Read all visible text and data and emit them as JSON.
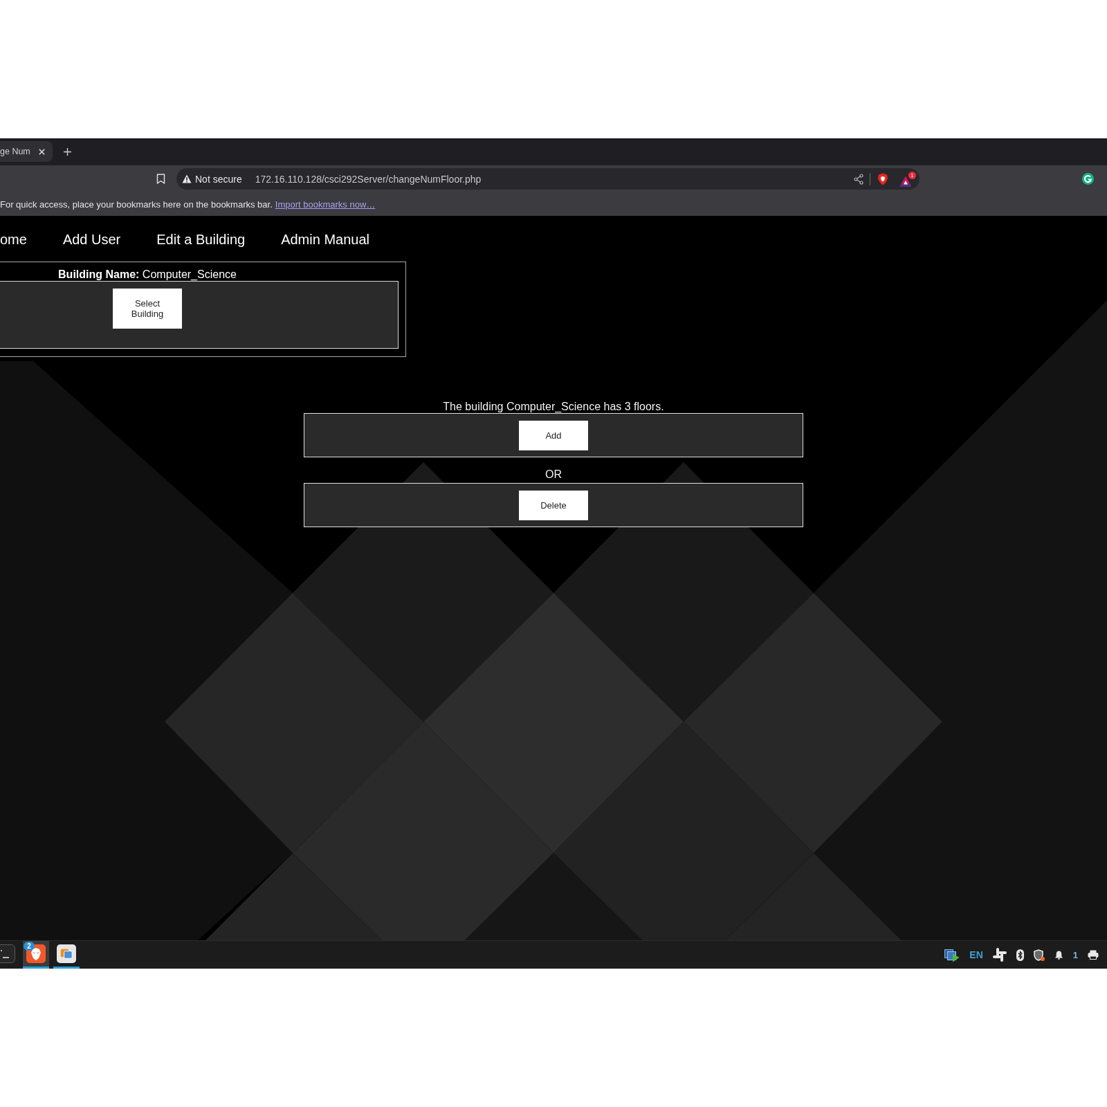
{
  "browser": {
    "tab": {
      "title": "ge Num"
    },
    "address_bar": {
      "security_label": "Not secure",
      "url": "172.16.110.128/csci292Server/changeNumFloor.php",
      "rewards_badge": "1"
    },
    "bookmarks_bar": {
      "hint": "For quick access, place your bookmarks here on the bookmarks bar.",
      "link": "Import bookmarks now…"
    }
  },
  "nav": {
    "items": [
      {
        "label": "ome"
      },
      {
        "label": "Add User"
      },
      {
        "label": "Edit a Building"
      },
      {
        "label": "Admin Manual"
      }
    ]
  },
  "building_panel": {
    "heading": "**Building Name:** Computer_Science",
    "button": "Select Building"
  },
  "floors": {
    "message": "The building Computer_Science has 3 floors.",
    "add_button": "Add",
    "separator": "OR",
    "delete_button": "Delete"
  },
  "taskbar": {
    "apps": [
      {
        "kind": "terminal",
        "selected": false,
        "running": false
      },
      {
        "kind": "browser",
        "selected": true,
        "running": true,
        "badge": "2"
      },
      {
        "kind": "virtualbox",
        "selected": false,
        "running": true
      }
    ],
    "tray": {
      "language": "EN",
      "notification_count": "1"
    }
  }
}
